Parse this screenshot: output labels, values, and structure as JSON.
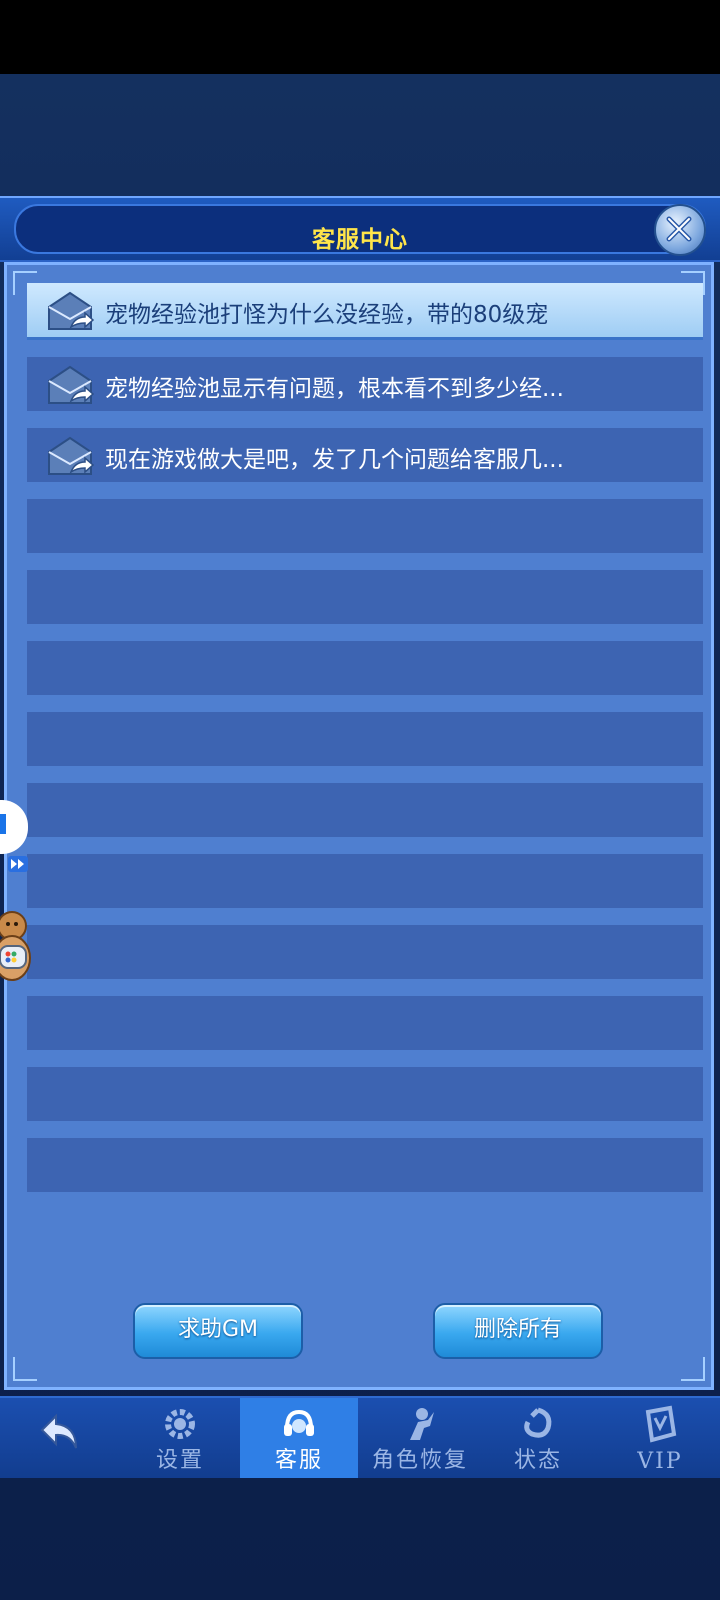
{
  "header": {
    "title": "客服中心"
  },
  "messages": [
    {
      "text": "宠物经验池打怪为什么没经验，带的80级宠",
      "selected": true
    },
    {
      "text": "宠物经验池显示有问题，根本看不到多少经..."
    },
    {
      "text": "现在游戏做大是吧，发了几个问题给客服几..."
    }
  ],
  "empty_rows": 10,
  "buttons": {
    "help_gm": "求助GM",
    "delete_all": "删除所有"
  },
  "nav": {
    "back_icon": "back-arrow-icon",
    "settings": "设置",
    "support": "客服",
    "role_restore": "角色恢复",
    "status": "状态",
    "vip": "VIP"
  },
  "colors": {
    "title_text": "#ffe54a",
    "panel": "#4f7fd0",
    "row": "#3d64b2",
    "nav_active": "#2f7fe6"
  }
}
